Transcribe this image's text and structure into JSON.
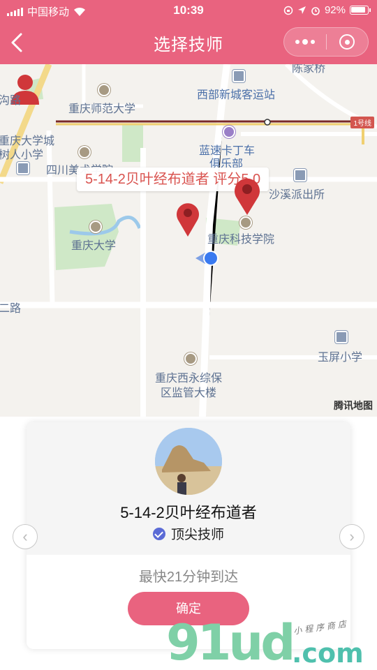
{
  "status_bar": {
    "carrier": "中国移动",
    "time": "10:39",
    "battery": "92%"
  },
  "nav": {
    "title": "选择技师",
    "back_icon": "chevron-left-icon",
    "more_icon": "more-dots-icon",
    "close_icon": "target-ring-icon"
  },
  "map": {
    "callout": "5-14-2贝叶经布道者   评分5.0",
    "line_tag": "1号线",
    "logo": "腾讯地图",
    "pois": [
      "重庆师范大学",
      "西部新城客运站",
      "重庆大学城",
      "树人小学",
      "四川美术学院",
      "蓝速卡丁车",
      "俱乐部",
      "沙溪派出所",
      "重庆大学",
      "重庆科技学院",
      "二路",
      "玉屏小学",
      "重庆西永综保",
      "区监管大楼",
      "陈家桥",
      "沟路"
    ]
  },
  "technician": {
    "name": "5-14-2贝叶经布道者",
    "level": "顶尖技师",
    "eta": "最快21分钟到达",
    "confirm": "确定"
  },
  "watermark": {
    "brand_main": "91ud",
    "brand_suffix": ".com",
    "tagline": "小程序商店"
  },
  "colors": {
    "accent": "#e9637f",
    "marker": "#d0373a",
    "verified": "#5b6bd6"
  }
}
